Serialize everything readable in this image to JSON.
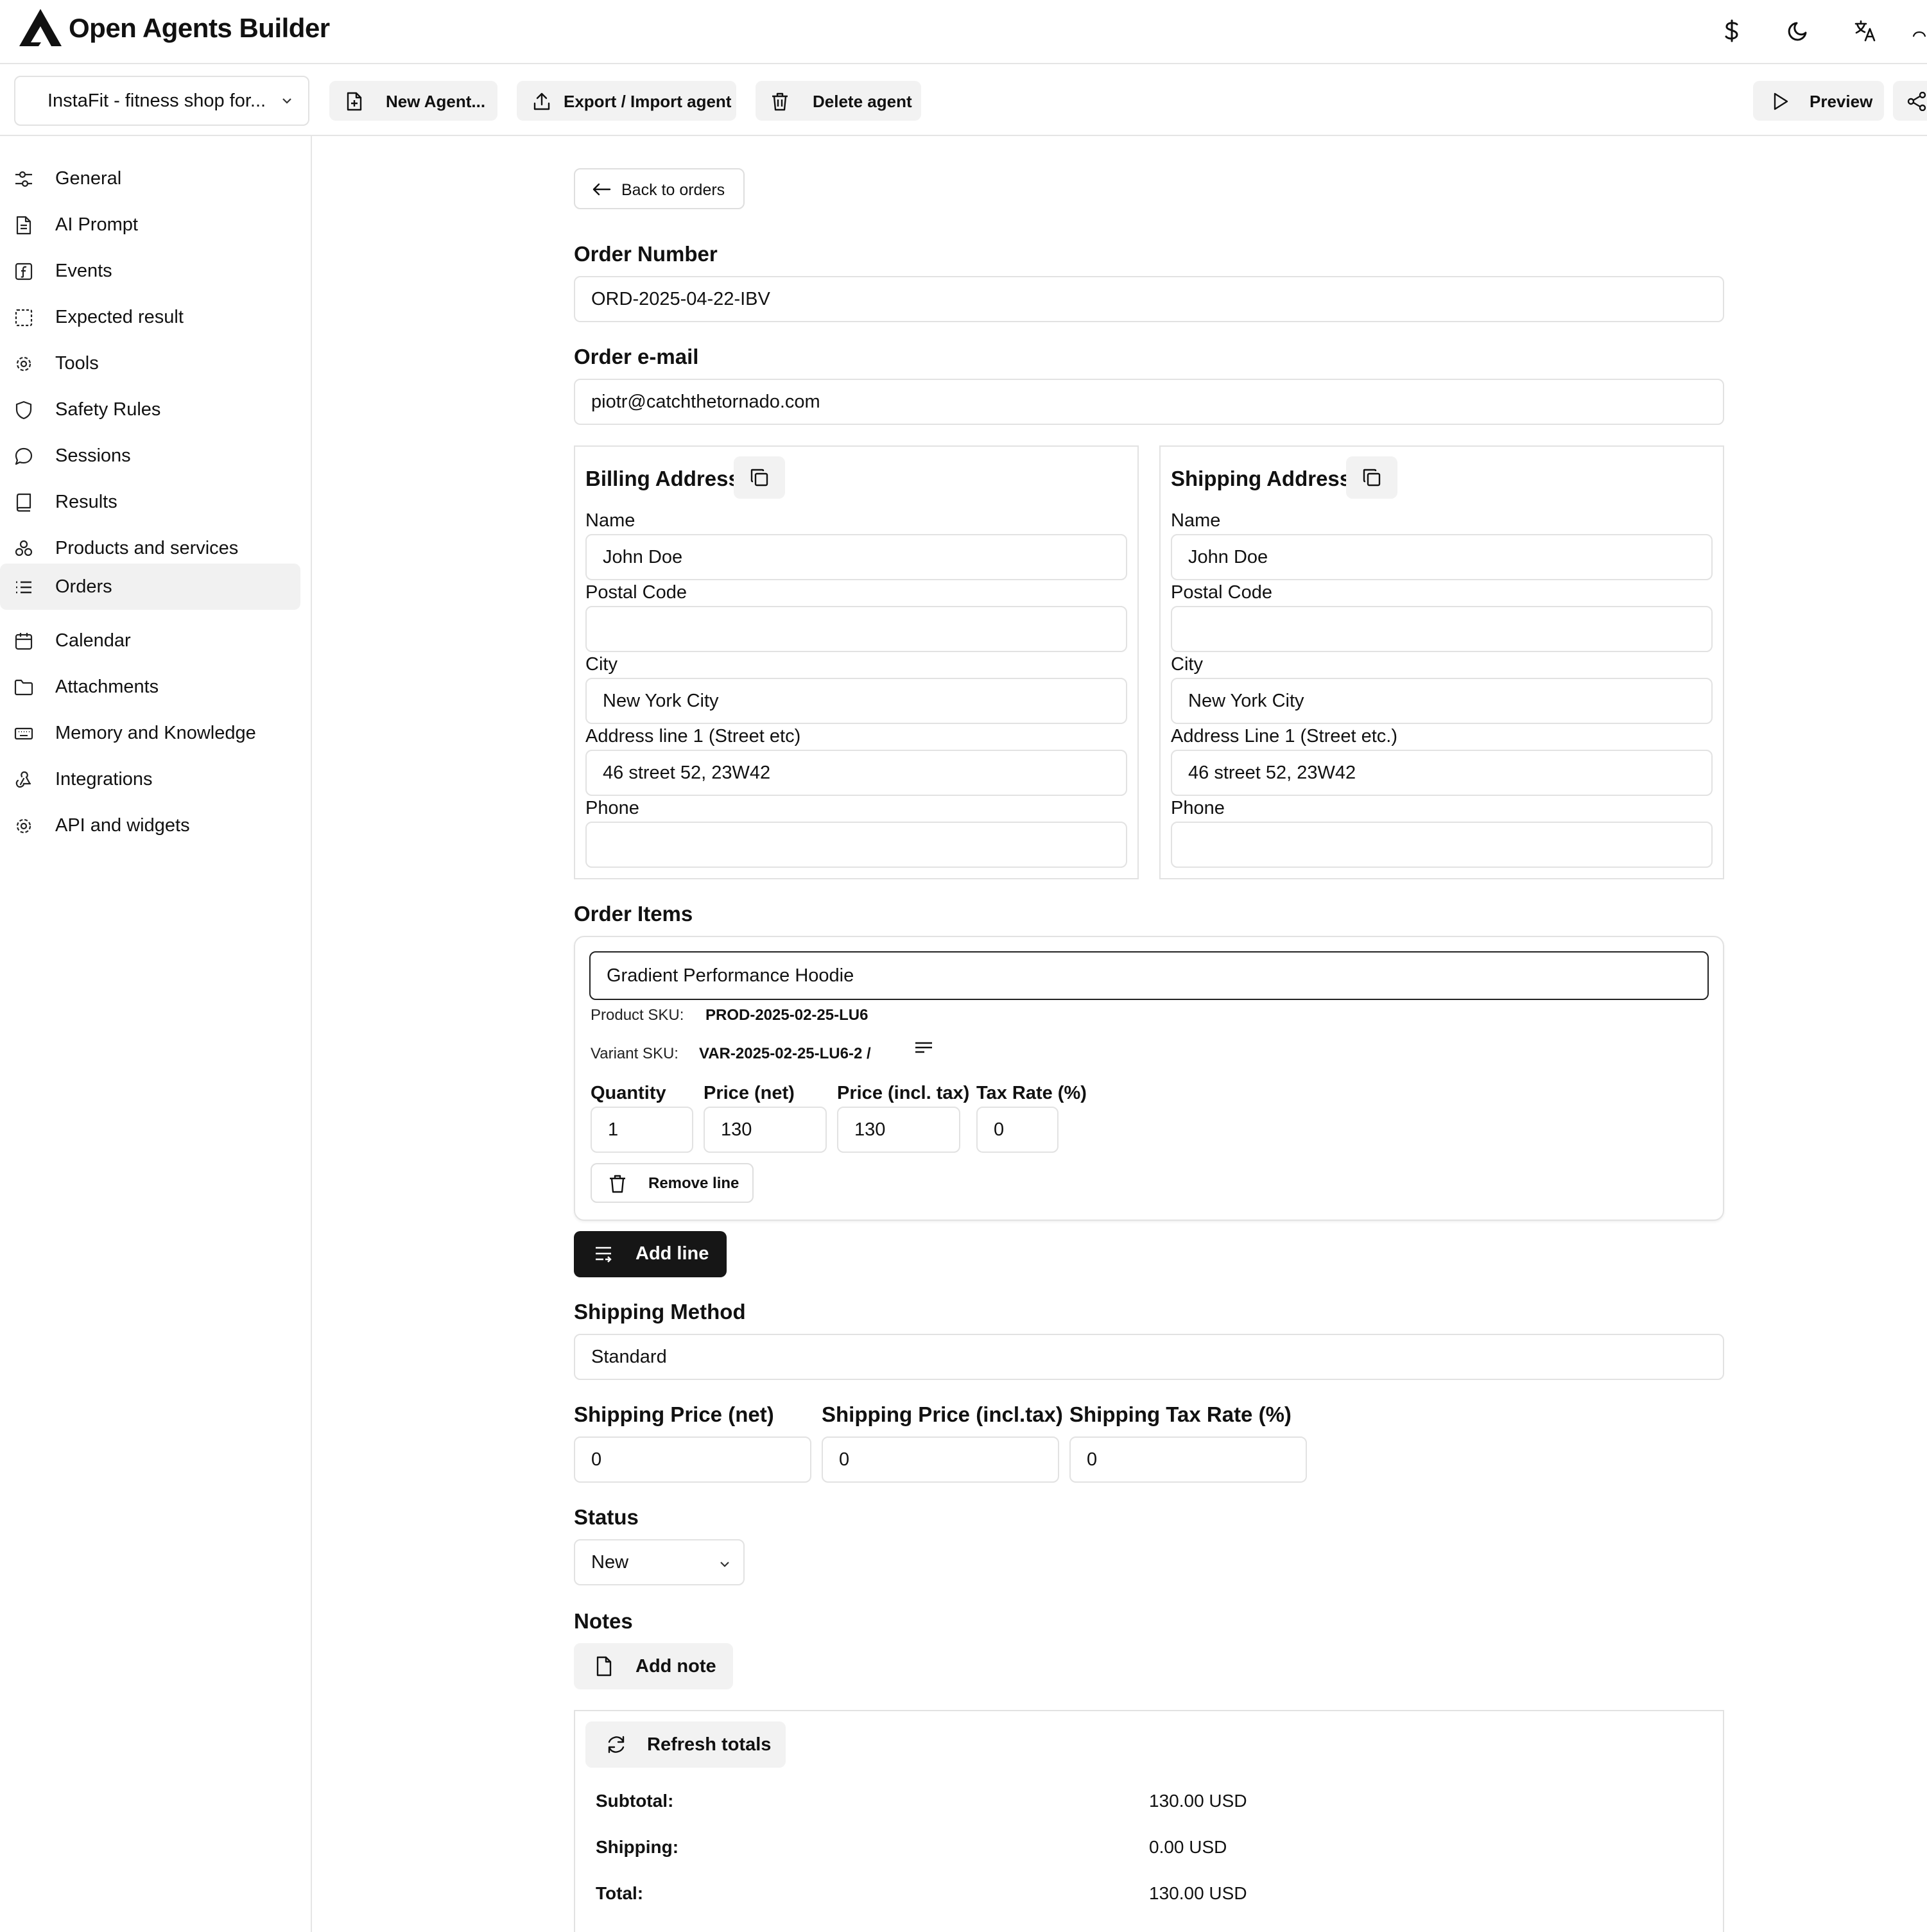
{
  "header": {
    "app_title": "Open Agents Builder",
    "icons": [
      "logo-icon",
      "dollar-icon",
      "moon-icon",
      "translate-icon",
      "user-icon"
    ]
  },
  "toolbar": {
    "agent_select": "InstaFit - fitness shop for...",
    "new_agent": "New Agent...",
    "export_import": "Export / Import agent",
    "delete_agent": "Delete agent",
    "preview": "Preview"
  },
  "sidebar": {
    "active": "Orders",
    "items": [
      {
        "label": "General",
        "icon": "sliders-icon"
      },
      {
        "label": "AI Prompt",
        "icon": "document-icon"
      },
      {
        "label": "Events",
        "icon": "function-icon"
      },
      {
        "label": "Expected result",
        "icon": "dashed-square-icon"
      },
      {
        "label": "Tools",
        "icon": "gear-icon"
      },
      {
        "label": "Safety Rules",
        "icon": "shield-icon"
      },
      {
        "label": "Sessions",
        "icon": "chat-icon"
      },
      {
        "label": "Results",
        "icon": "book-icon"
      },
      {
        "label": "Products and services",
        "icon": "boxes-icon"
      },
      {
        "label": "Orders",
        "icon": "list-icon"
      },
      {
        "label": "Calendar",
        "icon": "calendar-icon"
      },
      {
        "label": "Attachments",
        "icon": "folder-icon"
      },
      {
        "label": "Memory and Knowledge",
        "icon": "keyboard-icon"
      },
      {
        "label": "Integrations",
        "icon": "webhook-icon"
      },
      {
        "label": "API and widgets",
        "icon": "gear-icon"
      }
    ]
  },
  "main": {
    "back_button": "Back to orders",
    "order_number": {
      "label": "Order Number",
      "value": "ORD-2025-04-22-IBV"
    },
    "order_email": {
      "label": "Order e-mail",
      "value": "piotr@catchthetornado.com"
    },
    "billing": {
      "title": "Billing Address",
      "name_label": "Name",
      "name": "John Doe",
      "postal_label": "Postal Code",
      "postal": "",
      "city_label": "City",
      "city": "New York City",
      "address_label": "Address line 1 (Street etc)",
      "address": "46 street 52, 23W42",
      "phone_label": "Phone",
      "phone": ""
    },
    "shipping": {
      "title": "Shipping Address",
      "name_label": "Name",
      "name": "John Doe",
      "postal_label": "Postal Code",
      "postal": "",
      "city_label": "City",
      "city": "New York City",
      "address_label": "Address Line 1 (Street etc.)",
      "address": "46 street 52, 23W42",
      "phone_label": "Phone",
      "phone": ""
    },
    "order_items": {
      "label": "Order Items",
      "items": [
        {
          "product_name": "Gradient Performance Hoodie",
          "product_sku_label": "Product SKU:",
          "product_sku": "PROD-2025-02-25-LU6",
          "variant_sku_label": "Variant SKU:",
          "variant_sku": "VAR-2025-02-25-LU6-2 /",
          "quantity_label": "Quantity",
          "quantity": "1",
          "price_net_label": "Price (net)",
          "price_net": "130",
          "price_incl_label": "Price (incl. tax)",
          "price_incl": "130",
          "tax_rate_label": "Tax Rate (%)",
          "tax_rate": "0",
          "remove_label": "Remove line"
        }
      ],
      "add_line": "Add line"
    },
    "shipping_method": {
      "label": "Shipping Method",
      "value": "Standard"
    },
    "shipping_price_net": {
      "label": "Shipping Price (net)",
      "value": "0"
    },
    "shipping_price_incl": {
      "label": "Shipping Price (incl.tax)",
      "value": "0"
    },
    "shipping_tax_rate": {
      "label": "Shipping Tax Rate (%)",
      "value": "0"
    },
    "status": {
      "label": "Status",
      "value": "New"
    },
    "notes": {
      "label": "Notes",
      "add_note": "Add note"
    },
    "totals": {
      "refresh": "Refresh totals",
      "subtotal_label": "Subtotal:",
      "subtotal": "130.00 USD",
      "shipping_label": "Shipping:",
      "shipping": "0.00 USD",
      "total_label": "Total:",
      "total": "130.00 USD"
    }
  }
}
